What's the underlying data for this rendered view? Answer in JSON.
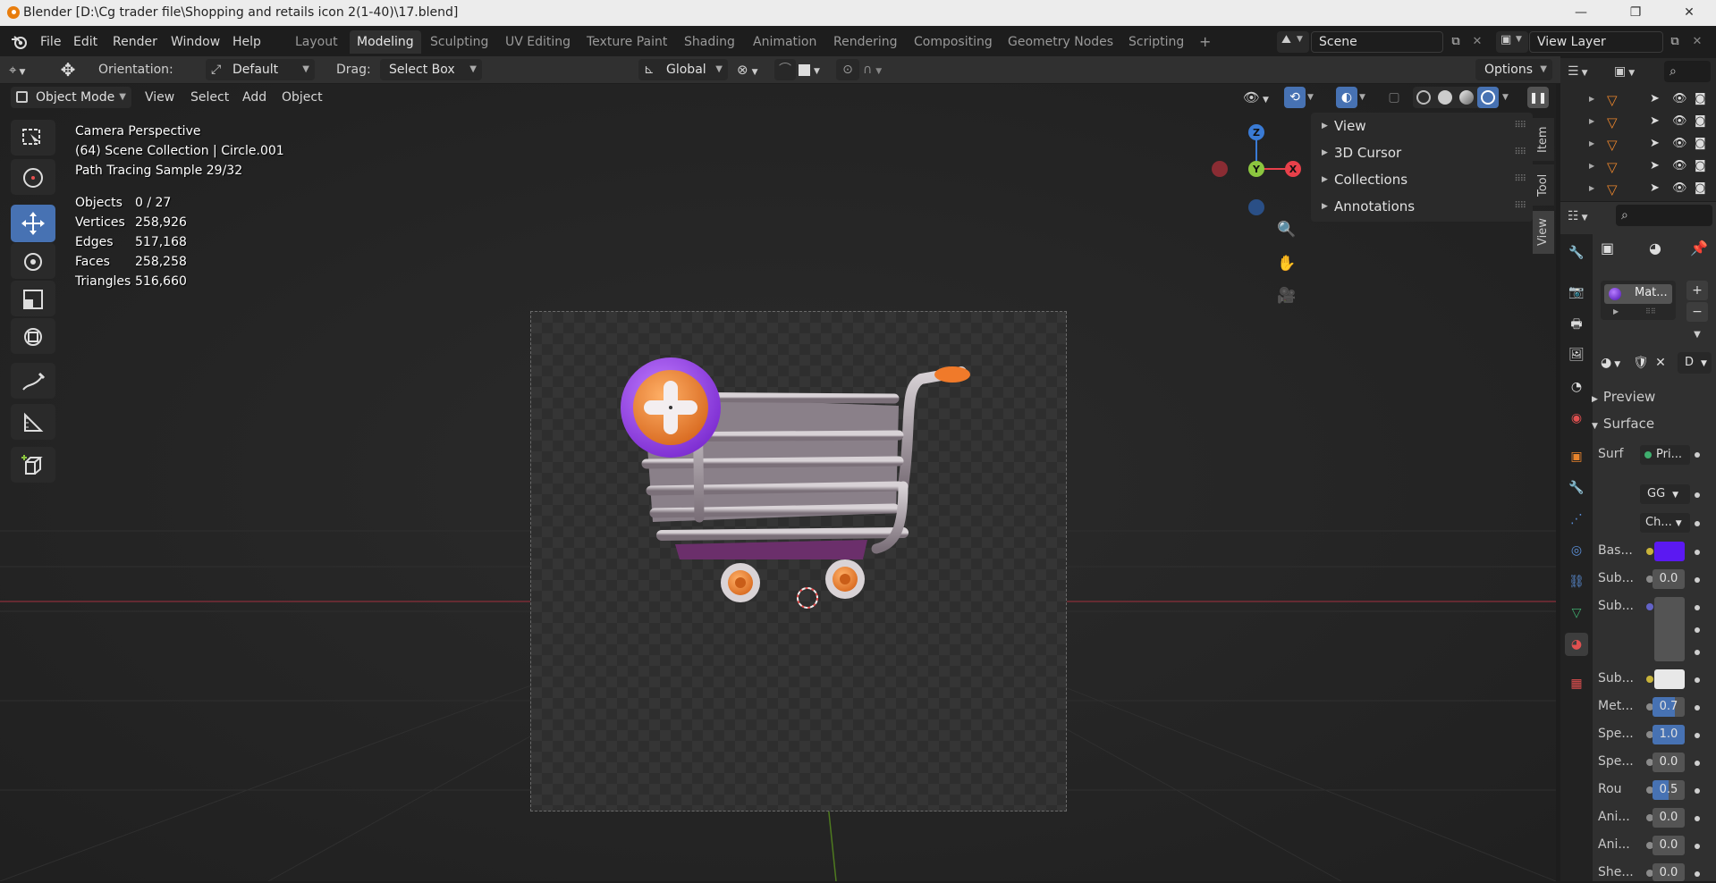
{
  "window": {
    "title": "Blender [D:\\Cg trader file\\Shopping and retails icon 2(1-40)\\17.blend]",
    "minimize_glyph": "—",
    "maximize_glyph": "❐",
    "close_glyph": "✕"
  },
  "menu": {
    "file": "File",
    "edit": "Edit",
    "render": "Render",
    "window": "Window",
    "help": "Help"
  },
  "workspaces": [
    "Layout",
    "Modeling",
    "Sculpting",
    "UV Editing",
    "Texture Paint",
    "Shading",
    "Animation",
    "Rendering",
    "Compositing",
    "Geometry Nodes",
    "Scripting",
    "+"
  ],
  "active_workspace": "Modeling",
  "scene": {
    "name": "Scene",
    "view_layer": "View Layer"
  },
  "tool_header": {
    "orientation_label": "Orientation:",
    "orientation_value": "Default",
    "drag_label": "Drag:",
    "drag_value": "Select Box",
    "transform_orientation": "Global",
    "options": "Options"
  },
  "viewport_header": {
    "mode": "Object Mode",
    "view": "View",
    "select": "Select",
    "add": "Add",
    "object": "Object"
  },
  "overlay": {
    "line1": "Camera Perspective",
    "line2": "(64) Scene Collection | Circle.001",
    "line3": "Path Tracing Sample 29/32",
    "stats": [
      {
        "label": "Objects",
        "value": "0 / 27"
      },
      {
        "label": "Vertices",
        "value": "258,926"
      },
      {
        "label": "Edges",
        "value": "517,168"
      },
      {
        "label": "Faces",
        "value": "258,258"
      },
      {
        "label": "Triangles",
        "value": "516,660"
      }
    ]
  },
  "gizmo": {
    "z": "Z",
    "y": "Y",
    "x": "X"
  },
  "npanel": {
    "rows": [
      "View",
      "3D Cursor",
      "Collections",
      "Annotations"
    ],
    "tabs": [
      "Item",
      "Tool",
      "View"
    ]
  },
  "material": {
    "slot_name": "Mat...",
    "link_label": "D",
    "preview": "Preview",
    "surface": "Surface",
    "surf_label": "Surf",
    "surf_value": "Pri...",
    "gg": "GG",
    "ch": "Ch...",
    "rows": [
      {
        "label": "Bas...",
        "value": ""
      },
      {
        "label": "Sub...",
        "value": "0.0"
      },
      {
        "label": "Sub...",
        "value": ""
      },
      {
        "label": "Sub...",
        "value": ""
      },
      {
        "label": "Met...",
        "value": "0.7"
      },
      {
        "label": "Spe...",
        "value": "1.0"
      },
      {
        "label": "Spe...",
        "value": "0.0"
      },
      {
        "label": "Rou",
        "value": "0.5"
      },
      {
        "label": "Ani...",
        "value": "0.0"
      },
      {
        "label": "Ani...",
        "value": "0.0"
      },
      {
        "label": "She...",
        "value": "0.0"
      }
    ],
    "base_color": "#5b19f2"
  },
  "colors": {
    "accent": "#4772b3",
    "axis_x": "#e8404a",
    "axis_y": "#8cc63f",
    "axis_z": "#3a7bd5",
    "cart_plus": "#8b3bd9",
    "cart_orange": "#e8842c"
  }
}
